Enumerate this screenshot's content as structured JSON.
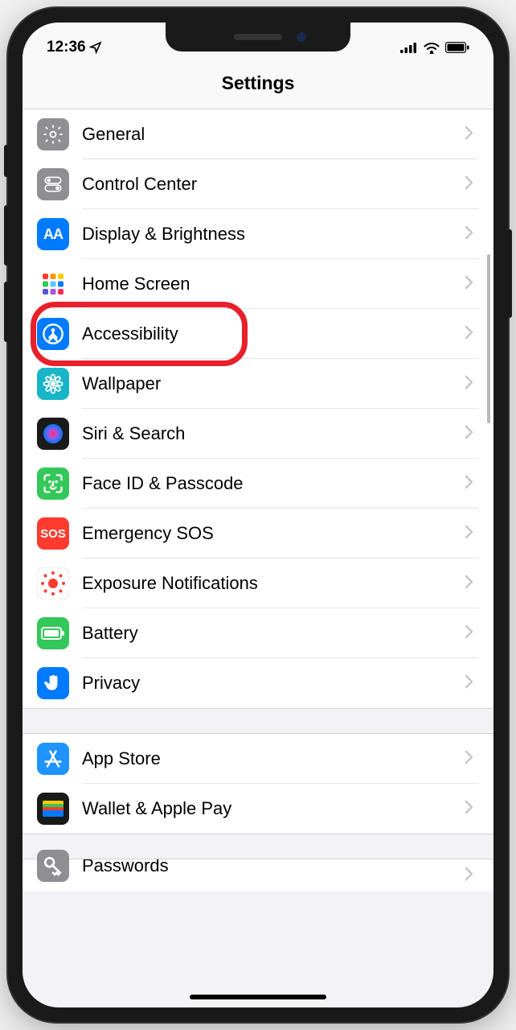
{
  "statusbar": {
    "time": "12:36"
  },
  "header": {
    "title": "Settings"
  },
  "sections": [
    {
      "rows": [
        {
          "id": "general",
          "label": "General",
          "icon": "gear",
          "bg": "#8e8e93"
        },
        {
          "id": "control-center",
          "label": "Control Center",
          "icon": "toggles",
          "bg": "#8e8e93"
        },
        {
          "id": "display",
          "label": "Display & Brightness",
          "icon": "aa",
          "bg": "#007aff"
        },
        {
          "id": "home-screen",
          "label": "Home Screen",
          "icon": "home-grid",
          "bg": "#3951b5"
        },
        {
          "id": "accessibility",
          "label": "Accessibility",
          "icon": "person-circle",
          "bg": "#007aff",
          "highlight": true
        },
        {
          "id": "wallpaper",
          "label": "Wallpaper",
          "icon": "flower",
          "bg": "#18b5c9"
        },
        {
          "id": "siri",
          "label": "Siri & Search",
          "icon": "siri",
          "bg": "#1a1a1a"
        },
        {
          "id": "faceid",
          "label": "Face ID & Passcode",
          "icon": "faceid",
          "bg": "#34c759"
        },
        {
          "id": "sos",
          "label": "Emergency SOS",
          "icon": "sos-text",
          "bg": "#ff3b30"
        },
        {
          "id": "exposure",
          "label": "Exposure Notifications",
          "icon": "exposure",
          "bg": "#ffffff"
        },
        {
          "id": "battery",
          "label": "Battery",
          "icon": "battery",
          "bg": "#34c759"
        },
        {
          "id": "privacy",
          "label": "Privacy",
          "icon": "hand",
          "bg": "#007aff"
        }
      ]
    },
    {
      "rows": [
        {
          "id": "appstore",
          "label": "App Store",
          "icon": "appstore",
          "bg": "#1f93ff"
        },
        {
          "id": "wallet",
          "label": "Wallet & Apple Pay",
          "icon": "wallet",
          "bg": "#1a1a1a"
        }
      ]
    },
    {
      "rows": [
        {
          "id": "passwords",
          "label": "Passwords",
          "icon": "key",
          "bg": "#8e8e93",
          "partial": true
        }
      ]
    }
  ]
}
